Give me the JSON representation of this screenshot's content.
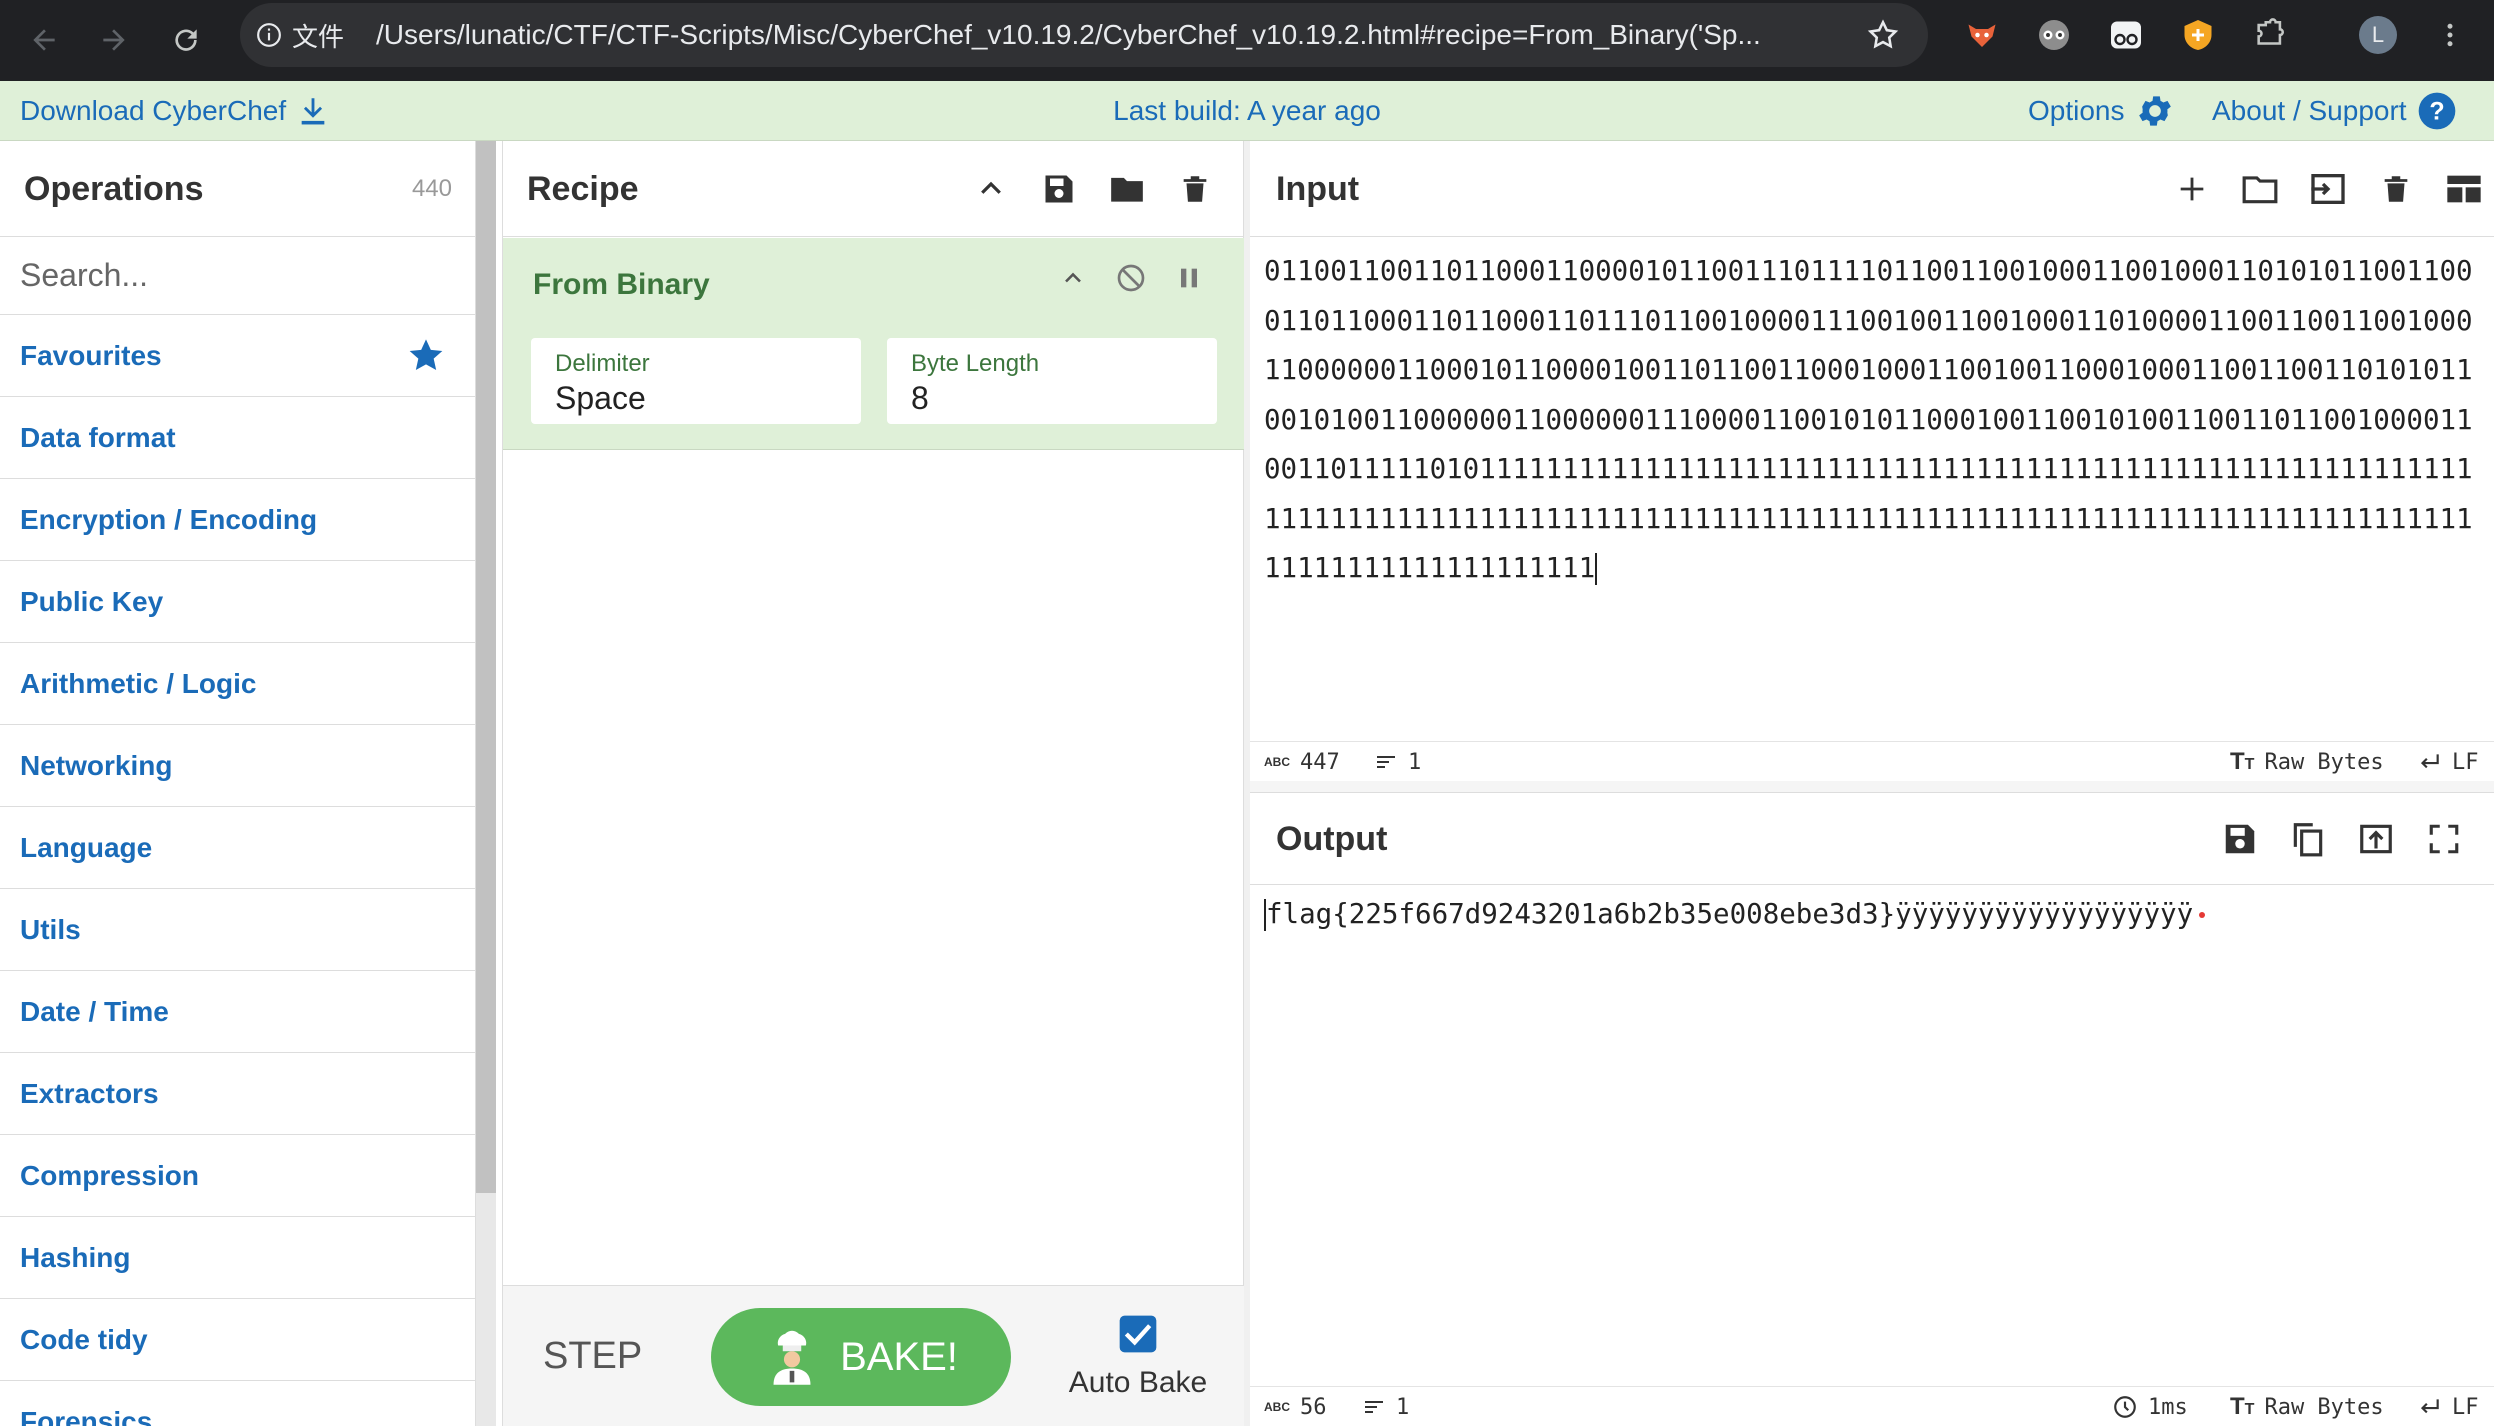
{
  "browser": {
    "site_label": "文件",
    "url": "/Users/lunatic/CTF/CTF-Scripts/Misc/CyberChef_v10.19.2/CyberChef_v10.19.2.html#recipe=From_Binary('Sp...",
    "profile_initial": "L"
  },
  "banner": {
    "download_label": "Download CyberChef",
    "last_build": "Last build: A year ago",
    "options_label": "Options",
    "about_label": "About / Support"
  },
  "operations": {
    "title": "Operations",
    "count": "440",
    "search_placeholder": "Search...",
    "categories": [
      "Favourites",
      "Data format",
      "Encryption / Encoding",
      "Public Key",
      "Arithmetic / Logic",
      "Networking",
      "Language",
      "Utils",
      "Date / Time",
      "Extractors",
      "Compression",
      "Hashing",
      "Code tidy",
      "Forensics"
    ]
  },
  "recipe": {
    "title": "Recipe",
    "operation": {
      "name": "From Binary",
      "delimiter_label": "Delimiter",
      "delimiter_value": "Space",
      "byte_length_label": "Byte Length",
      "byte_length_value": "8"
    },
    "step_label": "STEP",
    "bake_label": "BAKE!",
    "auto_bake_label": "Auto Bake",
    "auto_bake_checked": true
  },
  "input": {
    "title": "Input",
    "text": "01100110011011000110000101100111011110110011001000110010001101010110011000110110001101100011011101100100001110010011001000110100001100110011001000110000001100010110000100110110011000100011001001100010001100110011010101100101001100000011000000111000011001010110001001100101001100110110010000110011011111010111111111111111111111111111111111111111111111111111111111111111111111111111111111111111111111111111111111111111111111111111111111111111111111111111111111",
    "char_count": "447",
    "line_count": "1",
    "encoding": "Raw Bytes",
    "eol": "LF"
  },
  "output": {
    "title": "Output",
    "text": "flag{225f667d9243201a6b2b35e008ebe3d3}ÿÿÿÿÿÿÿÿÿÿÿÿÿÿÿÿÿÿ",
    "char_count": "56",
    "line_count": "1",
    "time": "1ms",
    "encoding": "Raw Bytes",
    "eol": "LF"
  },
  "colors": {
    "accent_blue": "#1a6bb8",
    "banner_green": "#dff0d8",
    "bake_green": "#5cb85c",
    "op_green_text": "#3c763d"
  }
}
